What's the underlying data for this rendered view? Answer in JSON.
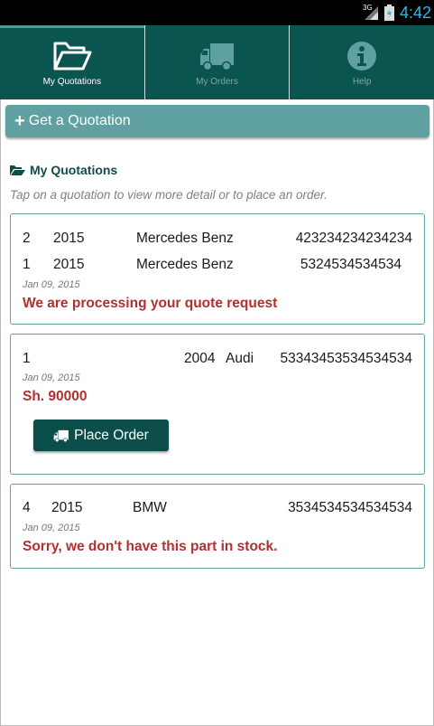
{
  "status_bar": {
    "network": "3G",
    "time": "4:42"
  },
  "tabs": [
    {
      "label": "My Quotations",
      "icon": "folder-open-icon",
      "active": true
    },
    {
      "label": "My Orders",
      "icon": "truck-icon",
      "active": false
    },
    {
      "label": "Help",
      "icon": "info-icon",
      "active": false
    }
  ],
  "get_quotation": {
    "icon": "plus-icon",
    "label": "Get a Quotation"
  },
  "section": {
    "icon": "folder-open-icon",
    "title": "My Quotations"
  },
  "hint": "Tap on a quotation to view more detail or to place an order.",
  "quotations": [
    {
      "items": [
        {
          "qty": "2",
          "year": "2015",
          "make": "Mercedes Benz",
          "part": "423234234234234"
        },
        {
          "qty": "1",
          "year": "2015",
          "make": "Mercedes Benz",
          "part": "5324534534534"
        }
      ],
      "date": "Jan 09, 2015",
      "message": "We are processing your quote request"
    },
    {
      "items": [
        {
          "qty": "1",
          "year": "2004",
          "make": "Audi",
          "part": "53343453534534534"
        }
      ],
      "date": "Jan 09, 2015",
      "message": "Sh. 90000",
      "action": {
        "icon": "truck-icon",
        "label": "Place Order"
      }
    },
    {
      "items": [
        {
          "qty": "4",
          "year": "2015",
          "make": "BMW",
          "part": "3534534534534534"
        }
      ],
      "date": "Jan 09, 2015",
      "message": "Sorry, we don't have this part in stock."
    }
  ],
  "colors": {
    "header": "#0b5551",
    "accent_button": "#5fa1a0",
    "action_button": "#0b4d49",
    "message_red": "#b03030",
    "card_border": "#5fa1a0"
  }
}
